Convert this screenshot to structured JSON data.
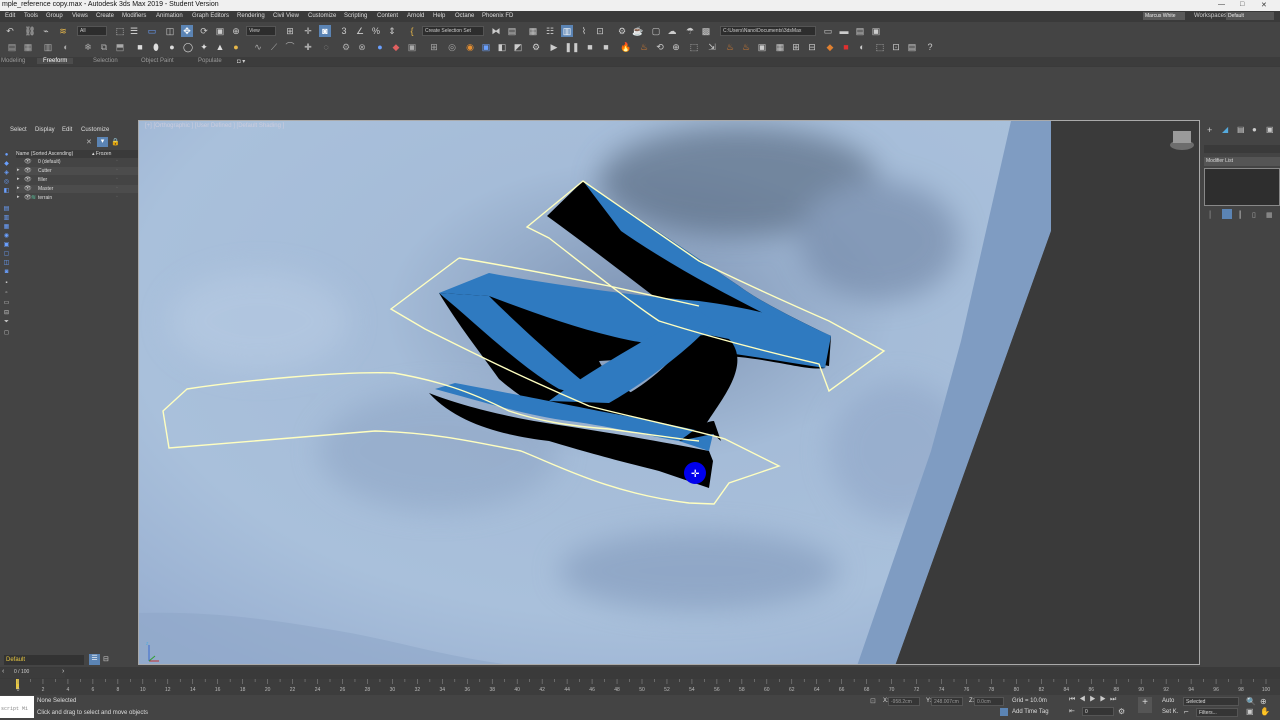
{
  "titlebar": {
    "title": "mple_reference copy.max - Autodesk 3ds Max 2019 - Student Version",
    "minimize": "—",
    "maximize": "□",
    "close": "✕"
  },
  "menu": [
    "Edit",
    "Tools",
    "Group",
    "Views",
    "Create",
    "Modifiers",
    "Animation",
    "Graph Editors",
    "Rendering",
    "Civil View",
    "Customize",
    "Scripting",
    "Content",
    "Arnold",
    "Help",
    "Octane",
    "Phoenix FD"
  ],
  "account": {
    "user": "Marcus White",
    "workspaces_label": "Workspaces:",
    "workspace": "Default"
  },
  "toolbar": {
    "filter_dropdown": "All",
    "view_dropdown": "View",
    "selection_set": "Create Selection Set",
    "project_path": "C:\\Users\\Nano\\Documents\\3dsMax"
  },
  "ribbon": {
    "tabs": [
      "Modeling",
      "Freeform",
      "Selection",
      "Object Paint",
      "Populate"
    ],
    "active": "Freeform"
  },
  "explorer": {
    "menu": [
      "Select",
      "Display",
      "Edit",
      "Customize"
    ],
    "column_name": "Name (Sorted Ascending)",
    "column_frozen": "▴ Frozen",
    "rows": [
      {
        "name": "0 (default)"
      },
      {
        "name": "Cutter"
      },
      {
        "name": "filler"
      },
      {
        "name": "Master"
      },
      {
        "name": "terrain"
      }
    ],
    "layer_dropdown": "Default"
  },
  "viewport": {
    "label": "[+] [Orthographic ] [User Defined ] [Default Shading ]",
    "axis": "z"
  },
  "command_panel": {
    "modifier_list": "Modifier List"
  },
  "timeline": {
    "frame_display": "0 / 100",
    "ticks": [
      "0",
      "2",
      "4",
      "6",
      "8",
      "10",
      "12",
      "14",
      "16",
      "18",
      "20",
      "22",
      "24",
      "26",
      "28",
      "30",
      "32",
      "34",
      "36",
      "38",
      "40",
      "42",
      "44",
      "46",
      "48",
      "50",
      "52",
      "54",
      "56",
      "58",
      "60",
      "62",
      "64",
      "66",
      "68",
      "70",
      "72",
      "74",
      "76",
      "78",
      "80",
      "82",
      "84",
      "86",
      "88",
      "90",
      "92",
      "94",
      "96",
      "98",
      "100"
    ]
  },
  "status": {
    "script_label": "script Mi",
    "selection": "None Selected",
    "prompt": "Click and drag to select and move objects",
    "x_label": "X:",
    "x_value": "-958.2cm",
    "y_label": "Y:",
    "y_value": "248.007cm",
    "z_label": "Z:",
    "z_value": "0.0cm",
    "grid": "Grid = 10.0m",
    "add_time_tag": "Add Time Tag",
    "auto": "Auto",
    "set_key": "Set K.",
    "selected": "Selected",
    "filters": "Filters...",
    "frame_field": "0"
  },
  "colors": {
    "viewport_bg": "#3b3b3b",
    "terrain": "#a3b9d4",
    "cliff": "#7f9cc2",
    "shape_top": "#2f7ac0",
    "shape_side": "#000000",
    "spline": "#ffffc0",
    "highlight": "#5b84b4"
  }
}
